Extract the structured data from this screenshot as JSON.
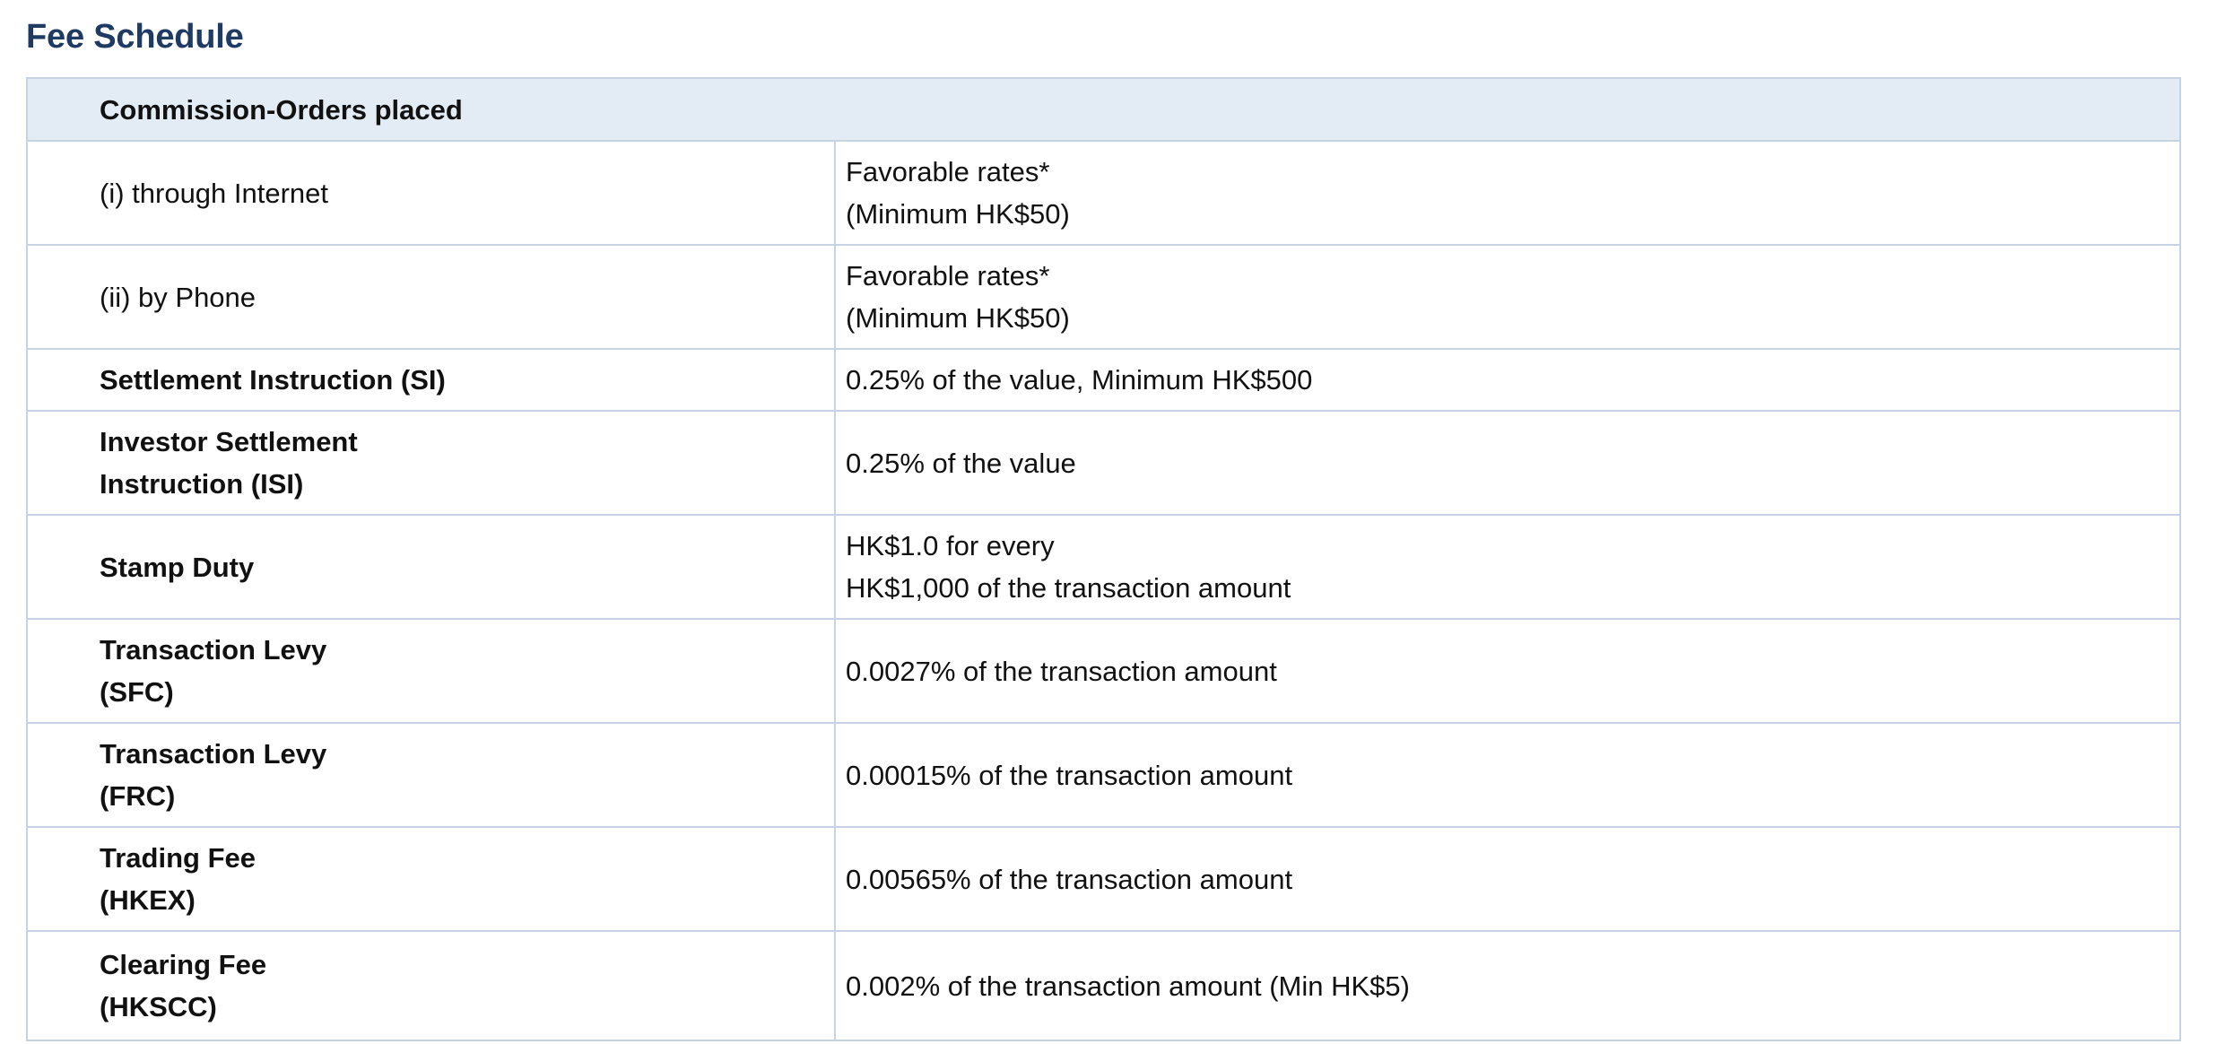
{
  "title": "Fee Schedule",
  "section_header": "Commission-Orders placed",
  "rows": [
    {
      "label": [
        "(i) through Internet"
      ],
      "value": [
        "Favorable rates*",
        "(Minimum HK$50)"
      ]
    },
    {
      "label": [
        "(ii) by Phone"
      ],
      "value": [
        "Favorable rates*",
        "(Minimum HK$50)"
      ]
    },
    {
      "label": [
        "Settlement Instruction (SI)"
      ],
      "value": [
        "0.25% of the value, Minimum HK$500"
      ]
    },
    {
      "label": [
        "Investor Settlement",
        "Instruction (ISI)"
      ],
      "value": [
        "0.25% of the value"
      ]
    },
    {
      "label": [
        "Stamp Duty"
      ],
      "value": [
        "HK$1.0 for every",
        "HK$1,000 of the transaction amount"
      ]
    },
    {
      "label": [
        "Transaction Levy",
        "(SFC)"
      ],
      "value": [
        "0.0027% of the transaction amount"
      ]
    },
    {
      "label": [
        "Transaction Levy",
        "(FRC)"
      ],
      "value": [
        "0.00015% of the transaction amount"
      ]
    },
    {
      "label": [
        "Trading Fee",
        "(HKEX)"
      ],
      "value": [
        "0.00565% of the transaction amount"
      ]
    },
    {
      "label": [
        "Clearing Fee",
        "(HKSCC)"
      ],
      "value": [
        "0.002% of the transaction amount (Min HK$5)"
      ]
    }
  ],
  "colors": {
    "title": "#1f3a63",
    "header_background": "#e3ebf4",
    "border": "#c5d3e3"
  }
}
